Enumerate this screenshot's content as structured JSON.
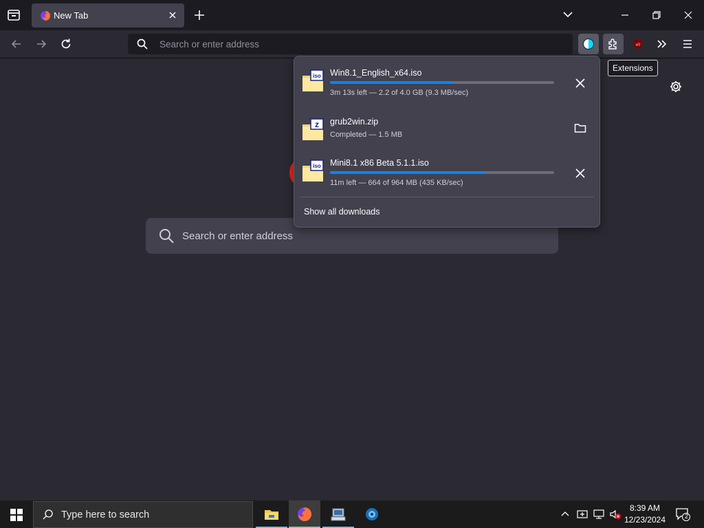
{
  "browser": {
    "tab": {
      "title": "New Tab",
      "favicon": "firefox-icon"
    },
    "urlbar": {
      "placeholder": "Search or enter address"
    },
    "tooltip": "Extensions"
  },
  "content": {
    "search_placeholder": "Search or enter address"
  },
  "downloads": {
    "items": [
      {
        "name": "Win8.1_English_x64.iso",
        "status": "3m 13s left — 2.2 of 4.0 GB (9.3 MB/sec)",
        "icon": "iso-file-icon",
        "progress": 0.55,
        "action": "cancel"
      },
      {
        "name": "grub2win.zip",
        "status": "Completed — 1.5 MB",
        "icon": "zip-file-icon",
        "progress": 1.0,
        "action": "open-folder"
      },
      {
        "name": "Mini8.1 x86 Beta 5.1.1.iso",
        "status": "11m left — 664 of 964 MB (435 KB/sec)",
        "icon": "iso-file-icon",
        "progress": 0.69,
        "action": "cancel"
      }
    ],
    "show_all": "Show all downloads"
  },
  "taskbar": {
    "search_placeholder": "Type here to search",
    "apps": [
      "file-explorer-icon",
      "firefox-icon",
      "network-app-icon",
      "settings-app-icon"
    ],
    "clock": {
      "time": "8:39 AM",
      "date": "12/23/2024"
    },
    "notifications": "2"
  },
  "colors": {
    "accent": "#0a84ff",
    "panel": "#42414d",
    "tabbar": "#1c1b22",
    "page": "#2b2a33"
  }
}
